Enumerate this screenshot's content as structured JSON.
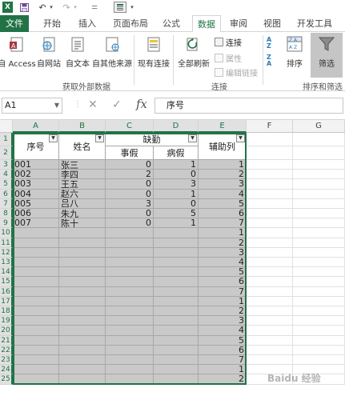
{
  "quick_access": {
    "icons": [
      "excel-logo-icon",
      "save-icon",
      "undo-icon",
      "redo-icon",
      "customize-icon",
      "form-icon"
    ]
  },
  "tabs": [
    "文件",
    "开始",
    "插入",
    "页面布局",
    "公式",
    "数据",
    "审阅",
    "视图",
    "开发工具"
  ],
  "active_tab": "数据",
  "ribbon": {
    "get_external": {
      "buttons": [
        "自 Access",
        "自网站",
        "自文本",
        "自其他来源",
        "现有连接"
      ],
      "group_label": "获取外部数据"
    },
    "connections": {
      "refresh_all": "全部刷新",
      "connect": "连接",
      "properties": "属性",
      "edit_links": "编辑链接",
      "group_label": "连接"
    },
    "sort_filter": {
      "sort": "排序",
      "filter": "筛选",
      "group_label": "排序和筛选"
    }
  },
  "formula_bar": {
    "name_box": "A1",
    "formula": "序号"
  },
  "columns": [
    "A",
    "B",
    "C",
    "D",
    "E",
    "F",
    "G"
  ],
  "rows": [
    "1",
    "2",
    "3",
    "4",
    "5",
    "6",
    "7",
    "8",
    "9",
    "10",
    "11",
    "12",
    "13",
    "14",
    "15",
    "16",
    "17",
    "18",
    "19",
    "20",
    "21",
    "22",
    "23",
    "24",
    "25"
  ],
  "table": {
    "headers": {
      "seq": "序号",
      "name": "姓名",
      "absence": "缺勤",
      "personal_leave": "事假",
      "sick_leave": "病假",
      "helper": "辅助列"
    },
    "records": [
      {
        "seq": "001",
        "name": "张三",
        "personal": "0",
        "sick": "1",
        "helper": "1"
      },
      {
        "seq": "002",
        "name": "李四",
        "personal": "2",
        "sick": "0",
        "helper": "2"
      },
      {
        "seq": "003",
        "name": "王五",
        "personal": "0",
        "sick": "3",
        "helper": "3"
      },
      {
        "seq": "004",
        "name": "赵六",
        "personal": "0",
        "sick": "1",
        "helper": "4"
      },
      {
        "seq": "005",
        "name": "吕八",
        "personal": "3",
        "sick": "0",
        "helper": "5"
      },
      {
        "seq": "006",
        "name": "朱九",
        "personal": "0",
        "sick": "5",
        "helper": "6"
      },
      {
        "seq": "007",
        "name": "陈十",
        "personal": "0",
        "sick": "1",
        "helper": "7"
      }
    ],
    "helper_extra": [
      "1",
      "2",
      "3",
      "4",
      "5",
      "6",
      "7",
      "1",
      "2",
      "3",
      "4",
      "5",
      "6",
      "7",
      "1",
      "2"
    ]
  },
  "watermark": "Baidu 经验",
  "colors": {
    "accent": "#217346",
    "shade": "#c9c9c9"
  }
}
